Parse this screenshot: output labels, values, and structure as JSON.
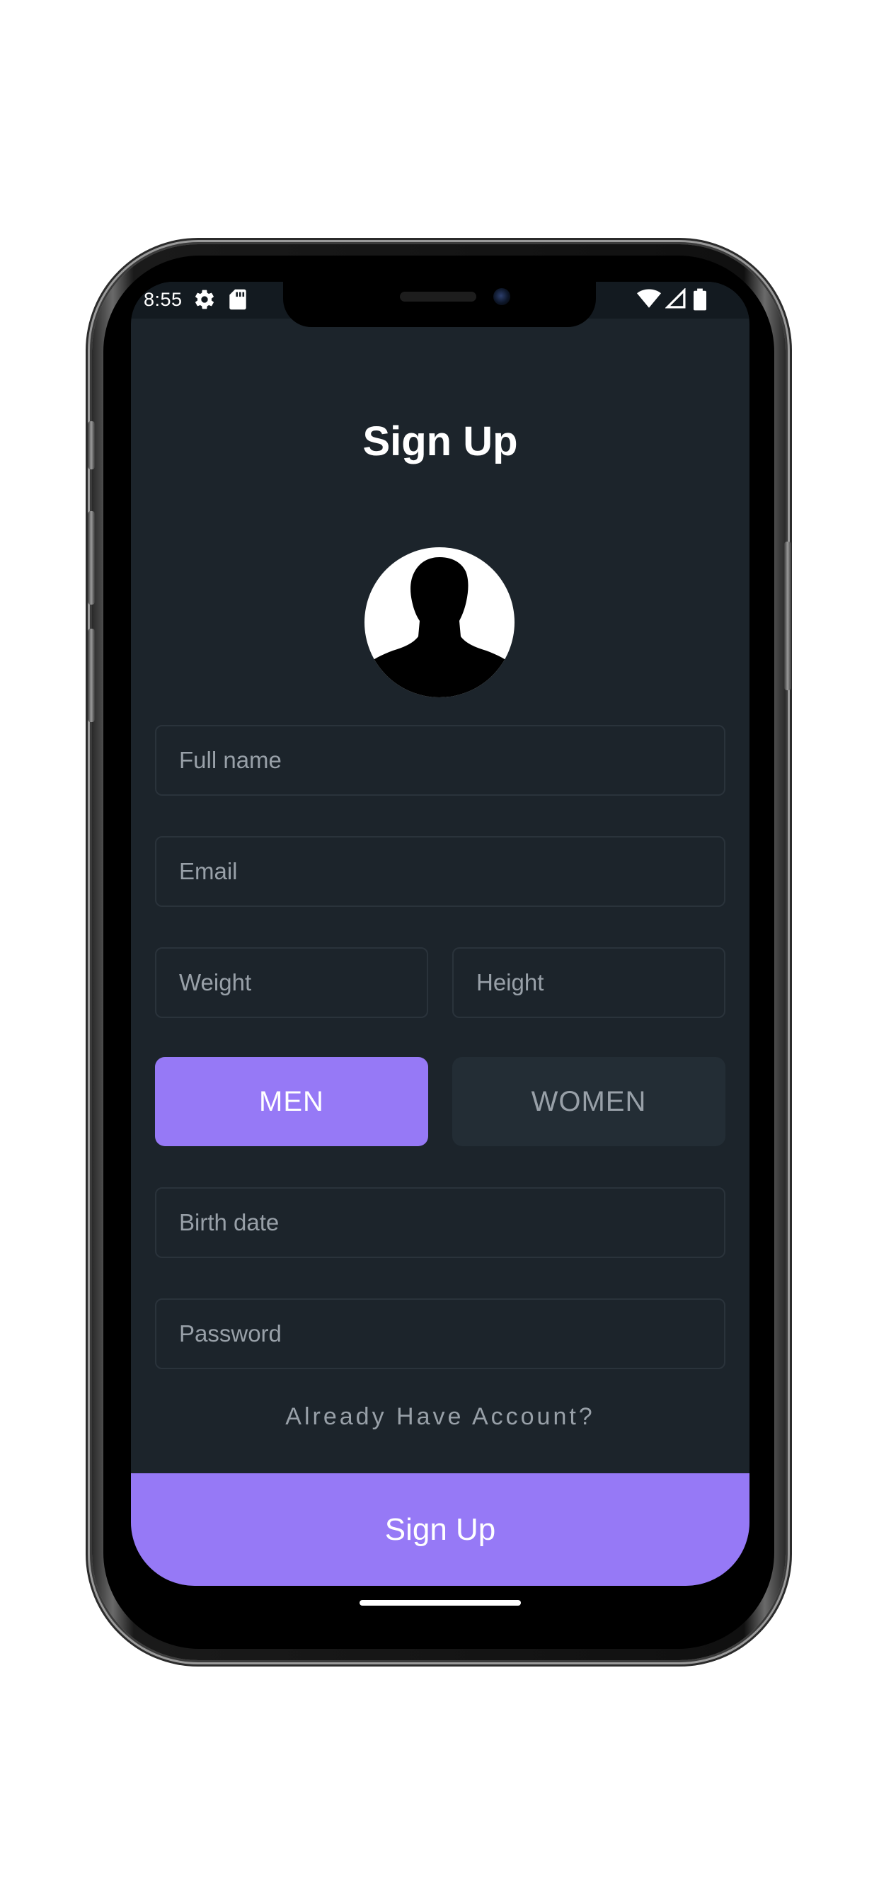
{
  "status_bar": {
    "time": "8:55",
    "icons": [
      "settings-gear-icon",
      "sd-card-icon",
      "wifi-icon",
      "cellular-signal-icon",
      "battery-icon"
    ]
  },
  "page": {
    "title": "Sign Up"
  },
  "avatar": {
    "icon": "user-silhouette-icon"
  },
  "form": {
    "full_name_placeholder": "Full name",
    "email_placeholder": "Email",
    "weight_placeholder": "Weight",
    "height_placeholder": "Height",
    "birth_date_placeholder": "Birth date",
    "password_placeholder": "Password"
  },
  "gender": {
    "men_label": "MEN",
    "women_label": "WOMEN",
    "selected": "MEN"
  },
  "links": {
    "already_have_account": "Already Have Account?"
  },
  "actions": {
    "signup_label": "Sign Up"
  },
  "colors": {
    "background": "#1c242b",
    "accent": "#9679f6",
    "text_primary": "#ffffff",
    "text_secondary": "#98a0a8"
  }
}
